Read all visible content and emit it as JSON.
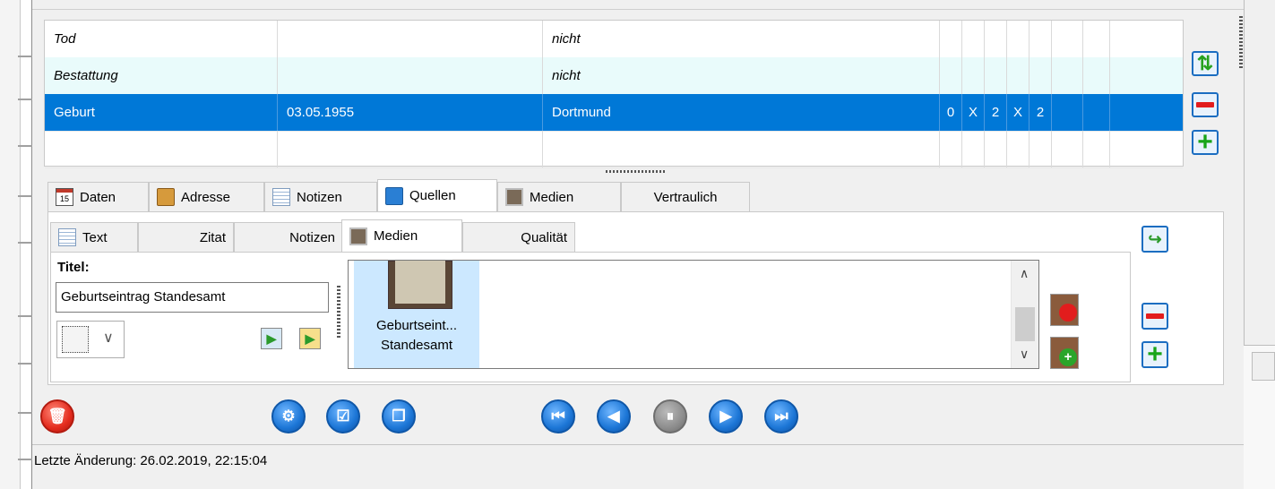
{
  "events_table": {
    "rows": [
      {
        "event": "Tod",
        "date": "",
        "place": "nicht",
        "flags": [
          "",
          "",
          "",
          "",
          "",
          ""
        ],
        "italic": true
      },
      {
        "event": "Bestattung",
        "date": "",
        "place": "nicht",
        "flags": [
          "",
          "",
          "",
          "",
          "",
          ""
        ],
        "italic": true
      },
      {
        "event": "Geburt",
        "date": "03.05.1955",
        "place": "Dortmund",
        "flags": [
          "0",
          "X",
          "2",
          "X",
          "2",
          ""
        ],
        "italic": false
      },
      {
        "event": "",
        "date": "",
        "place": "",
        "flags": [
          "",
          "",
          "",
          "",
          "",
          ""
        ],
        "italic": false
      }
    ]
  },
  "outer_tabs": {
    "daten": "Daten",
    "adresse": "Adresse",
    "notizen": "Notizen",
    "quellen": "Quellen",
    "medien": "Medien",
    "vertraulich": "Vertraulich",
    "calendar_day": "15"
  },
  "inner_tabs": {
    "text": "Text",
    "zitat": "Zitat",
    "notizen": "Notizen",
    "medien": "Medien",
    "qualitaet": "Qualität"
  },
  "media": {
    "title_label": "Titel:",
    "title_value": "Geburtseintrag Standesamt",
    "item_caption_line1": "Geburtseint...",
    "item_caption_line2": "Standesamt"
  },
  "status": {
    "last_change": "Letzte Änderung: 26.02.2019, 22:15:04"
  },
  "colors": {
    "selection": "#0078d7",
    "alt_row": "#e9fbfb",
    "button_blue": "#1c76d6",
    "delete_red": "#e42c1e"
  }
}
